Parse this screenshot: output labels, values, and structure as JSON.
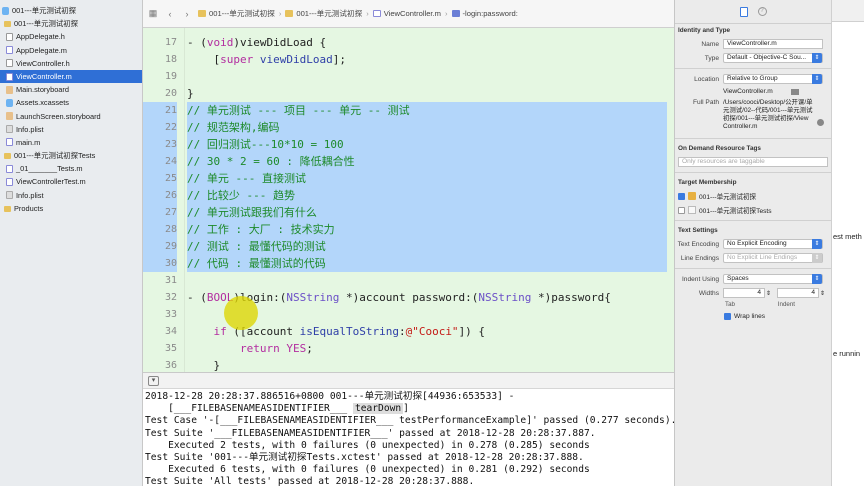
{
  "navigator": {
    "items": [
      {
        "label": "001---单元测试初探",
        "icon": "project-icon",
        "indent": 0,
        "selected": false
      },
      {
        "label": "001---单元测试初探",
        "icon": "folder-icon",
        "indent": 1,
        "selected": false
      },
      {
        "label": "AppDelegate.h",
        "icon": "h-file-icon",
        "indent": 2,
        "selected": false
      },
      {
        "label": "AppDelegate.m",
        "icon": "m-file-icon",
        "indent": 2,
        "selected": false
      },
      {
        "label": "ViewController.h",
        "icon": "h-file-icon",
        "indent": 2,
        "selected": false
      },
      {
        "label": "ViewController.m",
        "icon": "m-file-icon",
        "indent": 2,
        "selected": true
      },
      {
        "label": "Main.storyboard",
        "icon": "storyboard-icon",
        "indent": 2,
        "selected": false
      },
      {
        "label": "Assets.xcassets",
        "icon": "assets-icon",
        "indent": 2,
        "selected": false
      },
      {
        "label": "LaunchScreen.storyboard",
        "icon": "storyboard-icon",
        "indent": 2,
        "selected": false
      },
      {
        "label": "Info.plist",
        "icon": "plist-icon",
        "indent": 2,
        "selected": false
      },
      {
        "label": "main.m",
        "icon": "m-file-icon",
        "indent": 2,
        "selected": false
      },
      {
        "label": "001---单元测试初探Tests",
        "icon": "folder-icon",
        "indent": 1,
        "selected": false
      },
      {
        "label": "_01_______Tests.m",
        "icon": "m-file-icon",
        "indent": 2,
        "selected": false
      },
      {
        "label": "ViewControllerTest.m",
        "icon": "m-file-icon",
        "indent": 2,
        "selected": false
      },
      {
        "label": "Info.plist",
        "icon": "plist-icon",
        "indent": 2,
        "selected": false
      },
      {
        "label": "Products",
        "icon": "folder-icon",
        "indent": 1,
        "selected": false
      }
    ]
  },
  "pathbar": {
    "crumbs": [
      "001---单元测试初探",
      "001---单元测试初探",
      "ViewController.m",
      "-login:password:"
    ]
  },
  "editor": {
    "lines": [
      {
        "n": "16",
        "hl": false,
        "parts": [
          {
            "t": ""
          }
        ]
      },
      {
        "n": "17",
        "hl": false,
        "parts": [
          {
            "t": "- (",
            "c": ""
          },
          {
            "t": "void",
            "c": "kw"
          },
          {
            "t": ")viewDidLoad {"
          }
        ]
      },
      {
        "n": "18",
        "hl": false,
        "parts": [
          {
            "t": "    ["
          },
          {
            "t": "super",
            "c": "kw"
          },
          {
            "t": " "
          },
          {
            "t": "viewDidLoad",
            "c": "fn"
          },
          {
            "t": "];"
          }
        ]
      },
      {
        "n": "19",
        "hl": false,
        "parts": [
          {
            "t": ""
          }
        ]
      },
      {
        "n": "20",
        "hl": false,
        "parts": [
          {
            "t": "}"
          }
        ]
      },
      {
        "n": "21",
        "hl": true,
        "parts": [
          {
            "t": "// 单元测试 --- 项目 --- 单元 -- 测试",
            "c": "cm"
          }
        ]
      },
      {
        "n": "22",
        "hl": true,
        "parts": [
          {
            "t": "// 规范架构,编码",
            "c": "cm"
          }
        ]
      },
      {
        "n": "23",
        "hl": true,
        "parts": [
          {
            "t": "// 回归测试---10*10 = 100",
            "c": "cm"
          }
        ]
      },
      {
        "n": "24",
        "hl": true,
        "parts": [
          {
            "t": "// 30 * 2 = 60 : 降低耦合性",
            "c": "cm"
          }
        ]
      },
      {
        "n": "25",
        "hl": true,
        "parts": [
          {
            "t": "// 单元 --- 直接测试",
            "c": "cm"
          }
        ]
      },
      {
        "n": "26",
        "hl": true,
        "parts": [
          {
            "t": "// 比较少 --- 趋势",
            "c": "cm"
          }
        ]
      },
      {
        "n": "27",
        "hl": true,
        "parts": [
          {
            "t": "// 单元测试跟我们有什么",
            "c": "cm"
          }
        ]
      },
      {
        "n": "28",
        "hl": true,
        "parts": [
          {
            "t": "// 工作 : 大厂 : 技术实力",
            "c": "cm"
          }
        ]
      },
      {
        "n": "29",
        "hl": true,
        "parts": [
          {
            "t": "// 测试 : 最懂代码的测试",
            "c": "cm"
          }
        ]
      },
      {
        "n": "30",
        "hl": true,
        "parts": [
          {
            "t": "// 代码 : 最懂测试的代码",
            "c": "cm"
          }
        ]
      },
      {
        "n": "31",
        "hl": false,
        "parts": [
          {
            "t": ""
          }
        ]
      },
      {
        "n": "32",
        "hl": false,
        "parts": [
          {
            "t": "- ("
          },
          {
            "t": "BOOL",
            "c": "kw"
          },
          {
            "t": ")login:("
          },
          {
            "t": "NSString",
            "c": "ty"
          },
          {
            "t": " *)account password:("
          },
          {
            "t": "NSString",
            "c": "ty"
          },
          {
            "t": " *)password{"
          }
        ]
      },
      {
        "n": "33",
        "hl": false,
        "parts": [
          {
            "t": ""
          }
        ]
      },
      {
        "n": "34",
        "hl": false,
        "parts": [
          {
            "t": "    "
          },
          {
            "t": "if",
            "c": "kw"
          },
          {
            "t": " ([account "
          },
          {
            "t": "isEqualToString",
            "c": "fn"
          },
          {
            "t": ":"
          },
          {
            "t": "@\"Cooci\"",
            "c": "str"
          },
          {
            "t": "]) {"
          }
        ]
      },
      {
        "n": "35",
        "hl": false,
        "parts": [
          {
            "t": "        "
          },
          {
            "t": "return",
            "c": "kw"
          },
          {
            "t": " "
          },
          {
            "t": "YES",
            "c": "kw"
          },
          {
            "t": ";"
          }
        ]
      },
      {
        "n": "36",
        "hl": false,
        "parts": [
          {
            "t": "    }"
          }
        ]
      },
      {
        "n": "37",
        "hl": false,
        "parts": [
          {
            "t": "    "
          },
          {
            "t": "return",
            "c": "kw"
          },
          {
            "t": " "
          },
          {
            "t": "NO",
            "c": "kw"
          },
          {
            "t": ";"
          }
        ]
      },
      {
        "n": "38",
        "hl": false,
        "parts": [
          {
            "t": "}"
          }
        ]
      }
    ]
  },
  "console": {
    "lines": [
      "2018-12-28 20:28:37.886516+0800 001---单元测试初探[44936:653533] -",
      "    [___FILEBASENAMEASIDENTIFIER___ ",
      "Test Case '-[___FILEBASENAMEASIDENTIFIER___ testPerformanceExample]' passed (0.277 seconds).",
      "Test Suite '___FILEBASENAMEASIDENTIFIER___' passed at 2018-12-28 20:28:37.887.",
      "    Executed 2 tests, with 0 failures (0 unexpected) in 0.278 (0.285) seconds",
      "Test Suite '001---单元测试初探Tests.xctest' passed at 2018-12-28 20:28:37.888.",
      "    Executed 6 tests, with 0 failures (0 unexpected) in 0.281 (0.292) seconds",
      "Test Suite 'All tests' passed at 2018-12-28 20:28:37.888."
    ],
    "teardown": "tearDown",
    "line2_suffix": "]"
  },
  "inspector": {
    "identity_title": "Identity and Type",
    "name_label": "Name",
    "name_value": "ViewController.m",
    "type_label": "Type",
    "type_value": "Default - Objective-C Sou...",
    "location_label": "Location",
    "location_value": "Relative to Group",
    "location_file": "ViewController.m",
    "fullpath_label": "Full Path",
    "fullpath_value": "/Users/cooci/Desktop/公开课/单元测试/02--代码/001---单元测试初探/001---单元测试初探/ViewController.m",
    "odr_title": "On Demand Resource Tags",
    "odr_placeholder": "Only resources are taggable",
    "target_title": "Target Membership",
    "targets": [
      {
        "label": "001---单元测试初探",
        "checked": true
      },
      {
        "label": "001---单元测试初探Tests",
        "checked": false
      }
    ],
    "text_title": "Text Settings",
    "encoding_label": "Text Encoding",
    "encoding_value": "No Explicit Encoding",
    "line_endings_label": "Line Endings",
    "line_endings_value": "No Explicit Line Endings",
    "indent_using_label": "Indent Using",
    "indent_using_value": "Spaces",
    "widths_label": "Widths",
    "tab_width": "4",
    "indent_width": "4",
    "tab_caption": "Tab",
    "indent_caption": "Indent",
    "wrap_label": "Wrap lines"
  },
  "farright": {
    "frag1": "est meth",
    "frag2": "e runnin"
  }
}
